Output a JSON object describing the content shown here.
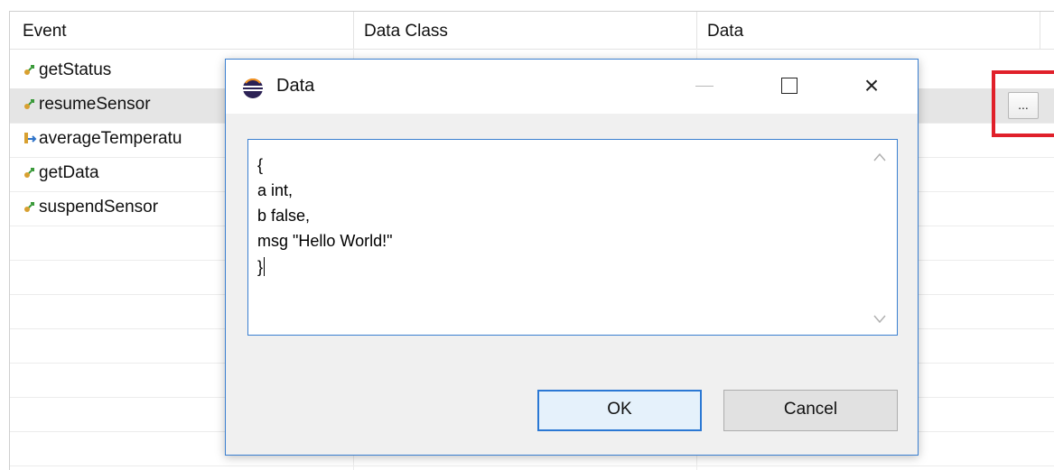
{
  "table": {
    "columns": [
      "Event",
      "Data Class",
      "Data"
    ],
    "rows": [
      {
        "event": "getStatus",
        "icon": "operation-icon",
        "selected": false
      },
      {
        "event": "resumeSensor",
        "icon": "operation-icon",
        "selected": true
      },
      {
        "event": "averageTemperatu",
        "icon": "output-event-icon",
        "selected": false
      },
      {
        "event": "getData",
        "icon": "operation-icon",
        "selected": false
      },
      {
        "event": "suspendSensor",
        "icon": "operation-icon",
        "selected": false
      }
    ],
    "ellipsis_label": "..."
  },
  "dialog": {
    "title": "Data",
    "icon": "eclipse-icon",
    "text_lines": [
      "{",
      "a int,",
      "b false,",
      "msg \"Hello World!\"",
      "}"
    ],
    "ok_label": "OK",
    "cancel_label": "Cancel"
  },
  "colors": {
    "accent": "#3a7fd0",
    "highlight": "#e0202a",
    "selected_row": "#e5e5e5"
  }
}
